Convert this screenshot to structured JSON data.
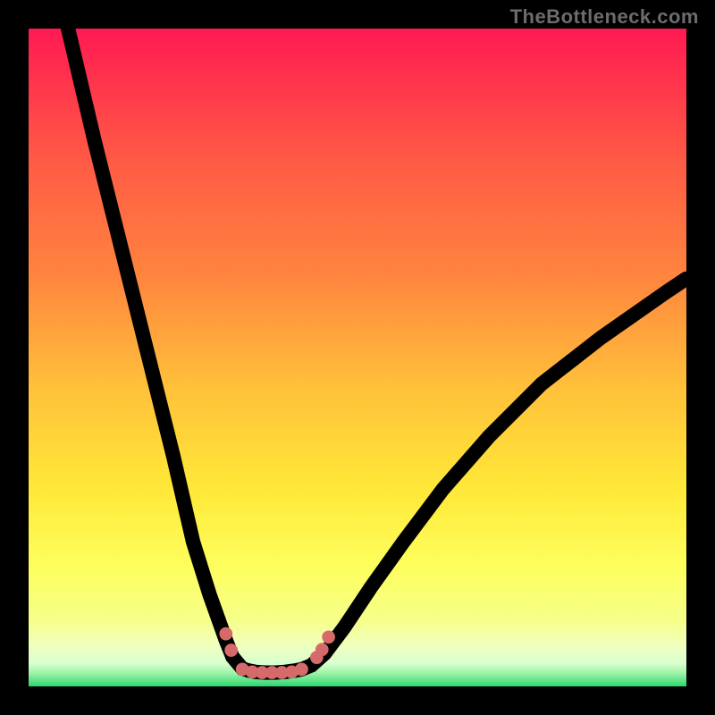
{
  "watermark": "TheBottleneck.com",
  "chart_data": {
    "type": "line",
    "title": "",
    "xlabel": "",
    "ylabel": "",
    "xlim": [
      0,
      100
    ],
    "ylim": [
      0,
      100
    ],
    "grid": false,
    "legend": false,
    "gradient": {
      "top_color": "#ff1a52",
      "mid_top_color": "#ff863e",
      "mid_color": "#ffe838",
      "mid_bottom_color": "#f6ff8a",
      "bottom_band_color": "#e9ffd0",
      "bottom_color": "#2bd86f"
    },
    "series": [
      {
        "name": "left-branch",
        "x": [
          6,
          10,
          14,
          18,
          22,
          25,
          27.5,
          30,
          31,
          32.5,
          33.5
        ],
        "y": [
          100,
          83,
          67,
          51,
          35,
          22,
          14,
          7,
          4.5,
          2.7,
          2.4
        ]
      },
      {
        "name": "valley",
        "x": [
          33.5,
          34.5,
          36,
          37.5,
          39,
          40.5,
          41.5
        ],
        "y": [
          2.4,
          2.2,
          2.1,
          2.1,
          2.2,
          2.4,
          2.6
        ]
      },
      {
        "name": "right-branch",
        "x": [
          41.5,
          43,
          45,
          48,
          52,
          57,
          63,
          70,
          78,
          87,
          97,
          100
        ],
        "y": [
          2.6,
          3.2,
          5,
          9,
          15,
          22,
          30,
          38,
          46,
          53,
          60,
          62
        ]
      }
    ],
    "markers": {
      "name": "valley-points",
      "color": "#d66a6a",
      "radius_pct": 1.0,
      "points": [
        {
          "x": 30.0,
          "y": 8.0
        },
        {
          "x": 30.8,
          "y": 5.5
        },
        {
          "x": 32.5,
          "y": 2.6
        },
        {
          "x": 34.0,
          "y": 2.2
        },
        {
          "x": 35.5,
          "y": 2.1
        },
        {
          "x": 37.0,
          "y": 2.1
        },
        {
          "x": 38.5,
          "y": 2.1
        },
        {
          "x": 40.0,
          "y": 2.2
        },
        {
          "x": 41.5,
          "y": 2.6
        },
        {
          "x": 43.8,
          "y": 4.4
        },
        {
          "x": 44.6,
          "y": 5.6
        },
        {
          "x": 45.6,
          "y": 7.5
        }
      ]
    }
  }
}
